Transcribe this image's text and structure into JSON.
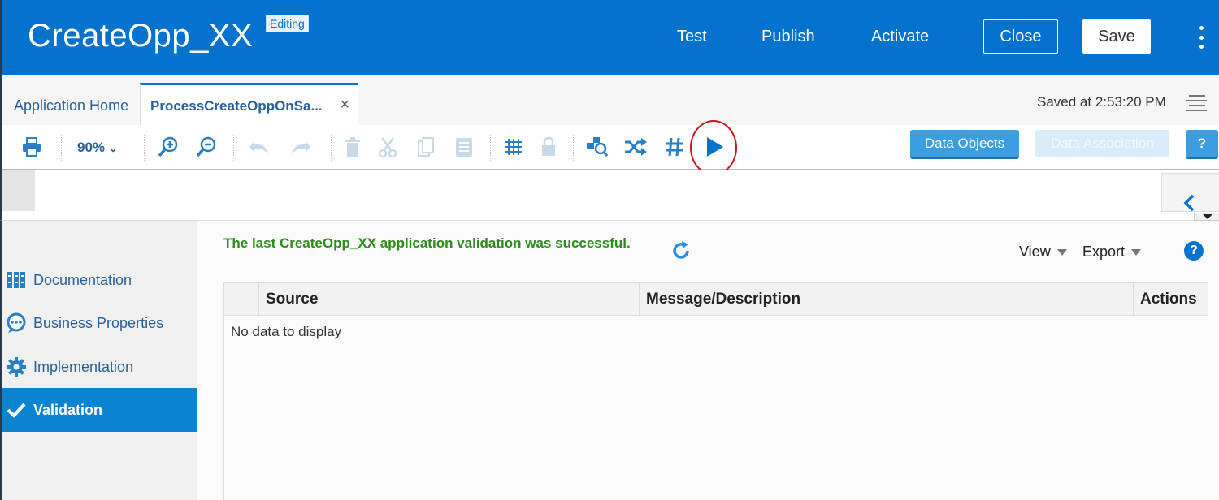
{
  "header": {
    "title": "CreateOpp_XX",
    "badge": "Editing",
    "links": [
      "Test",
      "Publish",
      "Activate"
    ],
    "close_label": "Close",
    "save_label": "Save"
  },
  "tabs": {
    "home": "Application Home",
    "active": "ProcessCreateOppOnSa...",
    "close_glyph": "×",
    "saved_status": "Saved at 2:53:20 PM"
  },
  "toolbar": {
    "zoom": "90%",
    "icons": [
      "print-icon",
      "zoom-in-icon",
      "zoom-out-icon",
      "undo-icon",
      "redo-icon",
      "delete-icon",
      "cut-icon",
      "copy-icon",
      "paste-icon",
      "grid-icon",
      "lock-icon",
      "find-icon",
      "shuffle-icon",
      "hash-icon",
      "run-icon"
    ],
    "data_objects": "Data Objects",
    "data_association": "Data Association",
    "help": "?"
  },
  "left_nav": {
    "items": [
      {
        "label": "Documentation",
        "icon": "documentation-icon"
      },
      {
        "label": "Business Properties",
        "icon": "business-properties-icon"
      },
      {
        "label": "Implementation",
        "icon": "gear-icon"
      },
      {
        "label": "Validation",
        "icon": "check-icon"
      }
    ],
    "active_index": 3
  },
  "validation": {
    "message": "The last CreateOpp_XX application validation was successful.",
    "view_label": "View",
    "export_label": "Export",
    "help": "?",
    "columns": [
      "Source",
      "Message/Description",
      "Actions"
    ],
    "empty_text": "No data to display"
  },
  "colors": {
    "brand": "#0572ce",
    "success": "#2e8b1e",
    "highlight": "#d0121b"
  }
}
